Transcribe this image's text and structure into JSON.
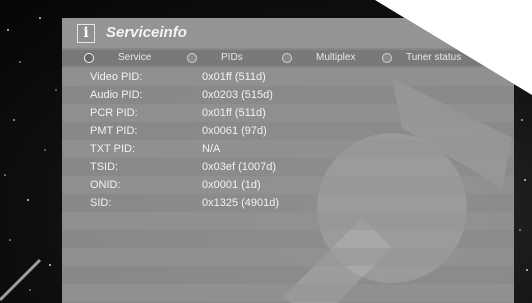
{
  "window": {
    "title": "Serviceinfo",
    "title_icon": "info-icon"
  },
  "tabs": [
    {
      "label": "Service",
      "selected": true
    },
    {
      "label": "PIDs",
      "selected": false
    },
    {
      "label": "Multiplex",
      "selected": false
    },
    {
      "label": "Tuner status",
      "selected": false
    }
  ],
  "info": [
    {
      "key": "Video PID:",
      "value": "0x01ff (511d)"
    },
    {
      "key": "Audio PID:",
      "value": "0x0203 (515d)"
    },
    {
      "key": "PCR PID:",
      "value": "0x01ff (511d)"
    },
    {
      "key": "PMT PID:",
      "value": "0x0061 (97d)"
    },
    {
      "key": "TXT PID:",
      "value": "N/A"
    },
    {
      "key": "TSID:",
      "value": "0x03ef (1007d)"
    },
    {
      "key": "ONID:",
      "value": "0x0001 (1d)"
    },
    {
      "key": "SID:",
      "value": "0x1325 (4901d)"
    }
  ]
}
